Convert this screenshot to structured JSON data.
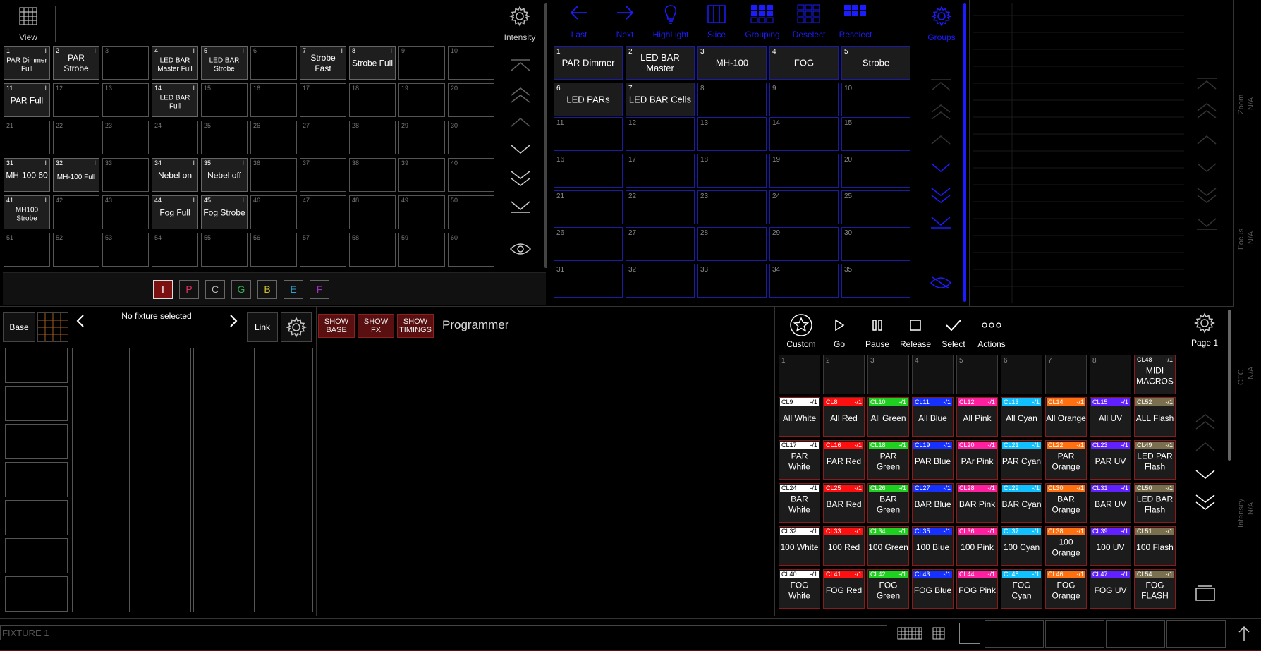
{
  "presets": {
    "view_label": "View",
    "intensity_label": "Intensity",
    "cells": [
      {
        "n": "1",
        "label": "PAR Dimmer Full",
        "filled": true,
        "flag": "I",
        "small": true
      },
      {
        "n": "2",
        "label": "PAR Strobe",
        "filled": true,
        "flag": "I"
      },
      {
        "n": "3",
        "label": "",
        "filled": false
      },
      {
        "n": "4",
        "label": "LED BAR Master Full",
        "filled": true,
        "flag": "I",
        "small": true
      },
      {
        "n": "5",
        "label": "LED BAR Strobe",
        "filled": true,
        "flag": "I",
        "small": true
      },
      {
        "n": "6",
        "label": "",
        "filled": false
      },
      {
        "n": "7",
        "label": "Strobe Fast",
        "filled": true,
        "flag": "I"
      },
      {
        "n": "8",
        "label": "Strobe Full",
        "filled": true,
        "flag": "I"
      },
      {
        "n": "9",
        "label": "",
        "filled": false
      },
      {
        "n": "10",
        "label": "",
        "filled": false
      },
      {
        "n": "11",
        "label": "PAR Full",
        "filled": true,
        "flag": "I"
      },
      {
        "n": "12",
        "label": "",
        "filled": false
      },
      {
        "n": "13",
        "label": "",
        "filled": false
      },
      {
        "n": "14",
        "label": "LED BAR Full",
        "filled": true,
        "flag": "I",
        "small": true
      },
      {
        "n": "15",
        "label": "",
        "filled": false
      },
      {
        "n": "16",
        "label": "",
        "filled": false
      },
      {
        "n": "17",
        "label": "",
        "filled": false
      },
      {
        "n": "18",
        "label": "",
        "filled": false
      },
      {
        "n": "19",
        "label": "",
        "filled": false
      },
      {
        "n": "20",
        "label": "",
        "filled": false
      },
      {
        "n": "21",
        "label": "",
        "filled": false
      },
      {
        "n": "22",
        "label": "",
        "filled": false
      },
      {
        "n": "23",
        "label": "",
        "filled": false
      },
      {
        "n": "24",
        "label": "",
        "filled": false
      },
      {
        "n": "25",
        "label": "",
        "filled": false
      },
      {
        "n": "26",
        "label": "",
        "filled": false
      },
      {
        "n": "27",
        "label": "",
        "filled": false
      },
      {
        "n": "28",
        "label": "",
        "filled": false
      },
      {
        "n": "29",
        "label": "",
        "filled": false
      },
      {
        "n": "30",
        "label": "",
        "filled": false
      },
      {
        "n": "31",
        "label": "MH-100 60",
        "filled": true,
        "flag": "I"
      },
      {
        "n": "32",
        "label": "MH-100 Full",
        "filled": true,
        "flag": "I",
        "small": true
      },
      {
        "n": "33",
        "label": "",
        "filled": false
      },
      {
        "n": "34",
        "label": "Nebel on",
        "filled": true,
        "flag": "I"
      },
      {
        "n": "35",
        "label": "Nebel off",
        "filled": true,
        "flag": "I"
      },
      {
        "n": "36",
        "label": "",
        "filled": false
      },
      {
        "n": "37",
        "label": "",
        "filled": false
      },
      {
        "n": "38",
        "label": "",
        "filled": false
      },
      {
        "n": "39",
        "label": "",
        "filled": false
      },
      {
        "n": "40",
        "label": "",
        "filled": false
      },
      {
        "n": "41",
        "label": "MH100 Strobe",
        "filled": true,
        "flag": "I",
        "small": true
      },
      {
        "n": "42",
        "label": "",
        "filled": false
      },
      {
        "n": "43",
        "label": "",
        "filled": false
      },
      {
        "n": "44",
        "label": "Fog Full",
        "filled": true,
        "flag": "I"
      },
      {
        "n": "45",
        "label": "Fog Strobe",
        "filled": true,
        "flag": "I"
      },
      {
        "n": "46",
        "label": "",
        "filled": false
      },
      {
        "n": "47",
        "label": "",
        "filled": false
      },
      {
        "n": "48",
        "label": "",
        "filled": false
      },
      {
        "n": "49",
        "label": "",
        "filled": false
      },
      {
        "n": "50",
        "label": "",
        "filled": false
      },
      {
        "n": "51",
        "label": "",
        "filled": false
      },
      {
        "n": "52",
        "label": "",
        "filled": false
      },
      {
        "n": "53",
        "label": "",
        "filled": false
      },
      {
        "n": "54",
        "label": "",
        "filled": false
      },
      {
        "n": "55",
        "label": "",
        "filled": false
      },
      {
        "n": "56",
        "label": "",
        "filled": false
      },
      {
        "n": "57",
        "label": "",
        "filled": false
      },
      {
        "n": "58",
        "label": "",
        "filled": false
      },
      {
        "n": "59",
        "label": "",
        "filled": false
      },
      {
        "n": "60",
        "label": "",
        "filled": false
      }
    ],
    "filters": [
      {
        "label": "I",
        "color": "#e03030",
        "active": true
      },
      {
        "label": "P",
        "color": "#e03060",
        "active": false
      },
      {
        "label": "C",
        "color": "#bbbbbb",
        "active": false
      },
      {
        "label": "G",
        "color": "#30b050",
        "active": false
      },
      {
        "label": "B",
        "color": "#d0c030",
        "active": false
      },
      {
        "label": "E",
        "color": "#30a0d0",
        "active": false
      },
      {
        "label": "F",
        "color": "#a030c0",
        "active": false
      }
    ]
  },
  "groups": {
    "toolbar": [
      {
        "label": "Last",
        "icon": "arrow-left-icon"
      },
      {
        "label": "Next",
        "icon": "arrow-right-icon"
      },
      {
        "label": "HighLight",
        "icon": "bulb-icon"
      },
      {
        "label": "Slice",
        "icon": "slice-icon"
      },
      {
        "label": "Grouping",
        "icon": "grouping-icon"
      },
      {
        "label": "Deselect",
        "icon": "deselect-icon"
      },
      {
        "label": "Reselect",
        "icon": "reselect-icon"
      }
    ],
    "groups_label": "Groups",
    "cells": [
      {
        "n": "1",
        "label": "PAR Dimmer",
        "filled": true
      },
      {
        "n": "2",
        "label": "LED BAR Master",
        "filled": true
      },
      {
        "n": "3",
        "label": "MH-100",
        "filled": true
      },
      {
        "n": "4",
        "label": "FOG",
        "filled": true
      },
      {
        "n": "5",
        "label": "Strobe",
        "filled": true
      },
      {
        "n": "6",
        "label": "LED PARs",
        "filled": true
      },
      {
        "n": "7",
        "label": "LED BAR Cells",
        "filled": true
      },
      {
        "n": "8",
        "label": "",
        "filled": false
      },
      {
        "n": "9",
        "label": "",
        "filled": false
      },
      {
        "n": "10",
        "label": "",
        "filled": false
      },
      {
        "n": "11",
        "label": "",
        "filled": false
      },
      {
        "n": "12",
        "label": "",
        "filled": false
      },
      {
        "n": "13",
        "label": "",
        "filled": false
      },
      {
        "n": "14",
        "label": "",
        "filled": false
      },
      {
        "n": "15",
        "label": "",
        "filled": false
      },
      {
        "n": "16",
        "label": "",
        "filled": false
      },
      {
        "n": "17",
        "label": "",
        "filled": false
      },
      {
        "n": "18",
        "label": "",
        "filled": false
      },
      {
        "n": "19",
        "label": "",
        "filled": false
      },
      {
        "n": "20",
        "label": "",
        "filled": false
      },
      {
        "n": "21",
        "label": "",
        "filled": false
      },
      {
        "n": "22",
        "label": "",
        "filled": false
      },
      {
        "n": "23",
        "label": "",
        "filled": false
      },
      {
        "n": "24",
        "label": "",
        "filled": false
      },
      {
        "n": "25",
        "label": "",
        "filled": false
      },
      {
        "n": "26",
        "label": "",
        "filled": false
      },
      {
        "n": "27",
        "label": "",
        "filled": false
      },
      {
        "n": "28",
        "label": "",
        "filled": false
      },
      {
        "n": "29",
        "label": "",
        "filled": false
      },
      {
        "n": "30",
        "label": "",
        "filled": false
      },
      {
        "n": "31",
        "label": "",
        "filled": false
      },
      {
        "n": "32",
        "label": "",
        "filled": false
      },
      {
        "n": "33",
        "label": "",
        "filled": false
      },
      {
        "n": "34",
        "label": "",
        "filled": false
      },
      {
        "n": "35",
        "label": "",
        "filled": false
      }
    ]
  },
  "encoders": {
    "labels": [
      {
        "name": "Zoom",
        "value": "N/A"
      },
      {
        "name": "Focus",
        "value": "N/A"
      },
      {
        "name": "CTC",
        "value": "N/A"
      },
      {
        "name": "Intensity",
        "value": "N/A"
      }
    ]
  },
  "fixture": {
    "base_label": "Base",
    "selection": "No fixture selected",
    "link_label": "Link"
  },
  "programmer": {
    "show_base": "SHOW BASE",
    "show_fx": "SHOW FX",
    "show_timings": "SHOW TIMINGS",
    "title": "Programmer"
  },
  "macros": {
    "toolbar": [
      {
        "label": "Custom",
        "icon": "star-icon"
      },
      {
        "label": "Go",
        "icon": "play-icon"
      },
      {
        "label": "Pause",
        "icon": "pause-icon"
      },
      {
        "label": "Release",
        "icon": "stop-icon"
      },
      {
        "label": "Select",
        "icon": "check-icon"
      },
      {
        "label": "Actions",
        "icon": "dots-icon"
      }
    ],
    "page_label": "Page 1",
    "rows": [
      [
        {
          "n": "1",
          "label": ""
        },
        {
          "n": "2",
          "label": ""
        },
        {
          "n": "3",
          "label": ""
        },
        {
          "n": "4",
          "label": ""
        },
        {
          "n": "5",
          "label": ""
        },
        {
          "n": "6",
          "label": ""
        },
        {
          "n": "7",
          "label": ""
        },
        {
          "n": "8",
          "label": ""
        },
        {
          "tag": "CL48",
          "suffix": "-/1",
          "label": "MIDI MACROS",
          "color": "#1c1c1c",
          "red": true
        }
      ],
      [
        {
          "tag": "CL9",
          "suffix": "-/1",
          "label": "All White",
          "color": "#ffffff"
        },
        {
          "tag": "CL8",
          "suffix": "-/1",
          "label": "All Red",
          "color": "#ff1010"
        },
        {
          "tag": "CL10",
          "suffix": "-/1",
          "label": "All Green",
          "color": "#20d020"
        },
        {
          "tag": "CL11",
          "suffix": "-/1",
          "label": "All Blue",
          "color": "#1530ff"
        },
        {
          "tag": "CL12",
          "suffix": "-/1",
          "label": "All Pink",
          "color": "#ff20a0"
        },
        {
          "tag": "CL13",
          "suffix": "-/1",
          "label": "All Cyan",
          "color": "#10c0ff"
        },
        {
          "tag": "CL14",
          "suffix": "-/1",
          "label": "All Orange",
          "color": "#ff7010"
        },
        {
          "tag": "CL15",
          "suffix": "-/1",
          "label": "All UV",
          "color": "#6020ff"
        },
        {
          "tag": "CL52",
          "suffix": "-/1",
          "label": "ALL Flash",
          "color": "#7a7050"
        }
      ],
      [
        {
          "tag": "CL17",
          "suffix": "-/1",
          "label": "PAR White",
          "color": "#ffffff"
        },
        {
          "tag": "CL16",
          "suffix": "-/1",
          "label": "PAR Red",
          "color": "#ff1010"
        },
        {
          "tag": "CL18",
          "suffix": "-/1",
          "label": "PAR Green",
          "color": "#20d020"
        },
        {
          "tag": "CL19",
          "suffix": "-/1",
          "label": "PAR Blue",
          "color": "#1530ff"
        },
        {
          "tag": "CL20",
          "suffix": "-/1",
          "label": "PAr Pink",
          "color": "#ff20a0"
        },
        {
          "tag": "CL21",
          "suffix": "-/1",
          "label": "PAR Cyan",
          "color": "#10c0ff"
        },
        {
          "tag": "CL22",
          "suffix": "-/1",
          "label": "PAR Orange",
          "color": "#ff7010"
        },
        {
          "tag": "CL23",
          "suffix": "-/1",
          "label": "PAR UV",
          "color": "#6020ff"
        },
        {
          "tag": "CL49",
          "suffix": "-/1",
          "label": "LED PAR Flash",
          "color": "#7a7050"
        }
      ],
      [
        {
          "tag": "CL24",
          "suffix": "-/1",
          "label": "BAR White",
          "color": "#ffffff"
        },
        {
          "tag": "CL25",
          "suffix": "-/1",
          "label": "BAR Red",
          "color": "#ff1010"
        },
        {
          "tag": "CL26",
          "suffix": "-/1",
          "label": "BAR Green",
          "color": "#20d020"
        },
        {
          "tag": "CL27",
          "suffix": "-/1",
          "label": "BAR Blue",
          "color": "#1530ff"
        },
        {
          "tag": "CL28",
          "suffix": "-/1",
          "label": "BAR Pink",
          "color": "#ff20a0"
        },
        {
          "tag": "CL29",
          "suffix": "-/1",
          "label": "BAR Cyan",
          "color": "#10c0ff"
        },
        {
          "tag": "CL30",
          "suffix": "-/1",
          "label": "BAR Orange",
          "color": "#ff7010"
        },
        {
          "tag": "CL31",
          "suffix": "-/1",
          "label": "BAR UV",
          "color": "#6020ff"
        },
        {
          "tag": "CL50",
          "suffix": "-/1",
          "label": "LED BAR Flash",
          "color": "#7a7050"
        }
      ],
      [
        {
          "tag": "CL32",
          "suffix": "-/1",
          "label": "100 White",
          "color": "#ffffff"
        },
        {
          "tag": "CL33",
          "suffix": "-/1",
          "label": "100 Red",
          "color": "#ff1010"
        },
        {
          "tag": "CL34",
          "suffix": "-/1",
          "label": "100 Green",
          "color": "#20d020"
        },
        {
          "tag": "CL35",
          "suffix": "-/1",
          "label": "100 Blue",
          "color": "#1530ff"
        },
        {
          "tag": "CL36",
          "suffix": "-/1",
          "label": "100 Pink",
          "color": "#ff20a0"
        },
        {
          "tag": "CL37",
          "suffix": "-/1",
          "label": "100 Cyan",
          "color": "#10c0ff"
        },
        {
          "tag": "CL38",
          "suffix": "-/1",
          "label": "100 Orange",
          "color": "#ff7010"
        },
        {
          "tag": "CL39",
          "suffix": "-/1",
          "label": "100 UV",
          "color": "#6020ff"
        },
        {
          "tag": "CL51",
          "suffix": "-/1",
          "label": "100 Flash",
          "color": "#7a7050"
        }
      ],
      [
        {
          "tag": "CL40",
          "suffix": "-/1",
          "label": "FOG White",
          "color": "#ffffff"
        },
        {
          "tag": "CL41",
          "suffix": "-/1",
          "label": "FOG Red",
          "color": "#ff1010"
        },
        {
          "tag": "CL42",
          "suffix": "-/1",
          "label": "FOG Green",
          "color": "#20d020"
        },
        {
          "tag": "CL43",
          "suffix": "-/1",
          "label": "FOG Blue",
          "color": "#1530ff"
        },
        {
          "tag": "CL44",
          "suffix": "-/1",
          "label": "FOG Pink",
          "color": "#ff20a0"
        },
        {
          "tag": "CL45",
          "suffix": "-/1",
          "label": "FOG Cyan",
          "color": "#10c0ff"
        },
        {
          "tag": "CL46",
          "suffix": "-/1",
          "label": "FOG Orange",
          "color": "#ff7010"
        },
        {
          "tag": "CL47",
          "suffix": "-/1",
          "label": "FOG UV",
          "color": "#6020ff"
        },
        {
          "tag": "CL54",
          "suffix": "-/1",
          "label": "FOG FLASH",
          "color": "#7a7050"
        }
      ]
    ]
  },
  "commandline": {
    "value": "FIXTURE 1"
  },
  "colors": {
    "accent_blue": "#1c1cff",
    "group_border": "#1c1ca0",
    "red_button": "#5a1010"
  }
}
